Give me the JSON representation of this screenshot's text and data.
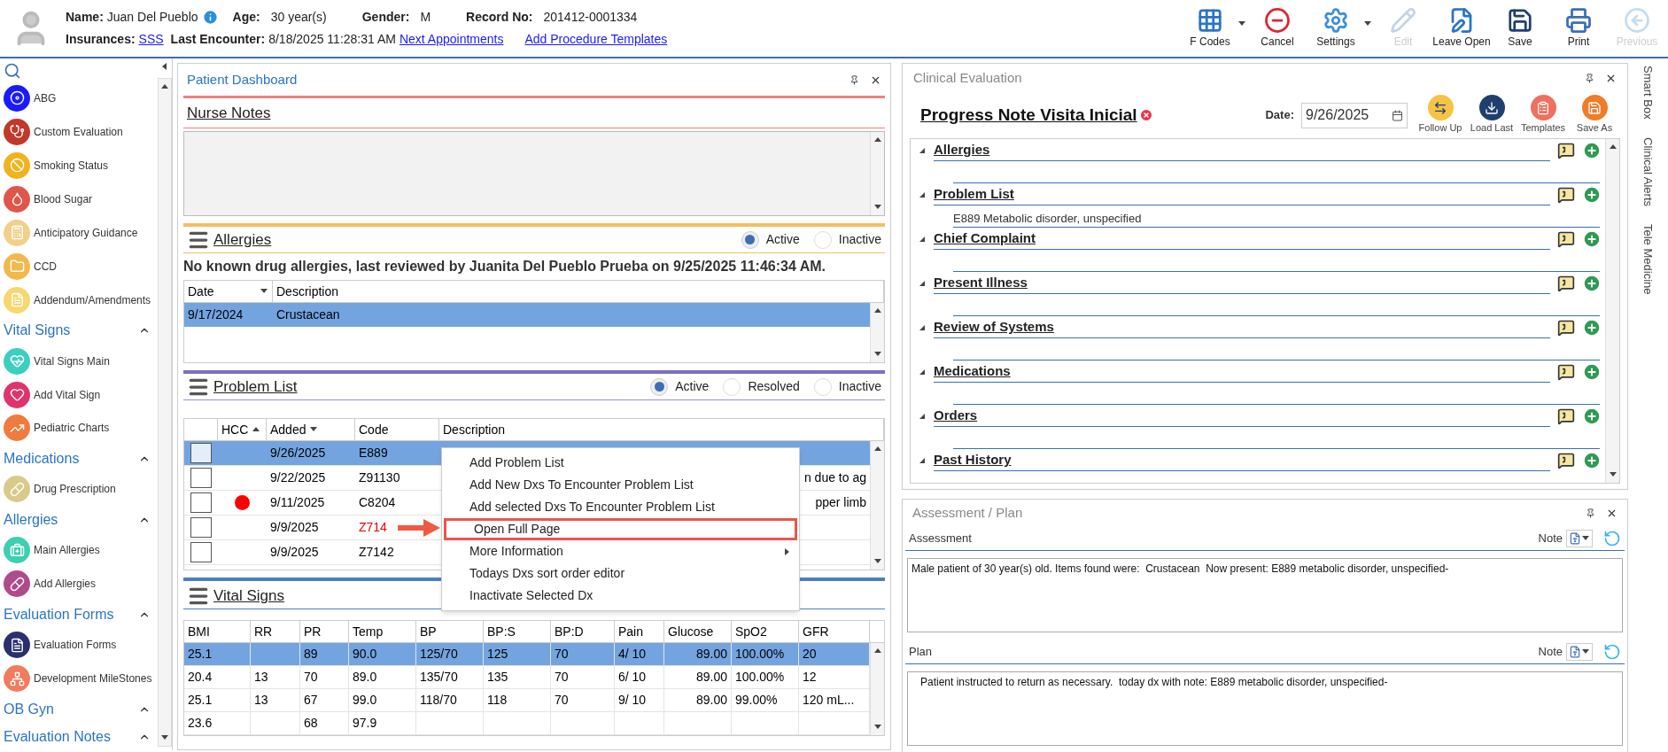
{
  "header": {
    "name_label": "Name:",
    "name": "Juan Del Pueblo",
    "age_label": "Age:",
    "age": "30 year(s)",
    "gender_label": "Gender:",
    "gender": "M",
    "record_label": "Record No:",
    "record": "201412-0001334",
    "insurances_label": "Insurances:",
    "insurance": "SSS",
    "last_encounter_label": "Last Encounter:",
    "last_encounter": "8/18/2025 11:28:31 AM",
    "links": [
      "Next Appointments",
      "Add Procedure Templates"
    ]
  },
  "toolbar": [
    {
      "kind": "fcodes",
      "label": "F Codes",
      "dropdown": true,
      "disabled": false
    },
    {
      "kind": "cancel",
      "label": "Cancel",
      "dropdown": false,
      "disabled": false
    },
    {
      "kind": "settings",
      "label": "Settings",
      "dropdown": true,
      "disabled": false
    },
    {
      "kind": "edit",
      "label": "Edit",
      "dropdown": false,
      "disabled": true
    },
    {
      "kind": "leave",
      "label": "Leave Open",
      "dropdown": false,
      "disabled": false
    },
    {
      "kind": "save",
      "label": "Save",
      "dropdown": false,
      "disabled": false
    },
    {
      "kind": "print",
      "label": "Print",
      "dropdown": false,
      "disabled": false
    },
    {
      "kind": "previous",
      "label": "Previous",
      "dropdown": false,
      "disabled": true
    }
  ],
  "sidebar": {
    "items": [
      {
        "kind": "item",
        "label": "ABG"
      },
      {
        "kind": "item",
        "label": "Custom Evaluation"
      },
      {
        "kind": "item",
        "label": "Smoking Status"
      },
      {
        "kind": "item",
        "label": "Blood Sugar"
      },
      {
        "kind": "item",
        "label": "Anticipatory Guidance"
      },
      {
        "kind": "item",
        "label": "CCD"
      },
      {
        "kind": "item",
        "label": "Addendum/Amendments"
      },
      {
        "kind": "section",
        "label": "Vital Signs",
        "expanded": true
      },
      {
        "kind": "item",
        "label": "Vital Signs Main"
      },
      {
        "kind": "item",
        "label": "Add Vital Sign"
      },
      {
        "kind": "item",
        "label": "Pediatric Charts"
      },
      {
        "kind": "section",
        "label": "Medications",
        "expanded": true
      },
      {
        "kind": "item",
        "label": "Drug Prescription"
      },
      {
        "kind": "section",
        "label": "Allergies",
        "expanded": true
      },
      {
        "kind": "item",
        "label": "Main Allergies"
      },
      {
        "kind": "item",
        "label": "Add Allergies"
      },
      {
        "kind": "section",
        "label": "Evaluation Forms",
        "expanded": true
      },
      {
        "kind": "item",
        "label": "Evaluation Forms"
      },
      {
        "kind": "item",
        "label": "Development MileStones"
      },
      {
        "kind": "section",
        "label": "OB Gyn",
        "expanded": true
      },
      {
        "kind": "section",
        "label": "Evaluation Notes",
        "expanded": true
      }
    ]
  },
  "dashboard": {
    "title": "Patient Dashboard",
    "nurse_notes": {
      "title": "Nurse Notes"
    },
    "allergies": {
      "title": "Allergies",
      "filters": [
        {
          "label": "Active",
          "selected": true
        },
        {
          "label": "Inactive",
          "selected": false
        }
      ],
      "summary": "No known drug allergies, last reviewed by Juanita Del Pueblo Prueba on 9/25/2025 11:46:34 AM.",
      "columns": [
        {
          "label": "Date",
          "sorted": true,
          "ascending": false
        },
        {
          "label": "Description",
          "sorted": false
        }
      ],
      "rows": [
        {
          "cells": [
            "9/17/2024",
            "Crustacean"
          ],
          "selected": true
        }
      ]
    },
    "problem_list": {
      "title": "Problem List",
      "filters": [
        {
          "label": "Active",
          "selected": true
        },
        {
          "label": "Resolved",
          "selected": false
        },
        {
          "label": "Inactive",
          "selected": false
        }
      ],
      "columns": [
        {
          "label": "HCC",
          "sorted": true,
          "ascending": true
        },
        {
          "label": "Added",
          "sorted": true,
          "ascending": false
        },
        {
          "label": "Code",
          "sorted": false
        },
        {
          "label": "Description",
          "sorted": false
        }
      ],
      "rows": [
        {
          "checked": false,
          "selected": true,
          "hcc": false,
          "added": "9/26/2025",
          "code": "E889",
          "flagged": false
        },
        {
          "checked": false,
          "selected": false,
          "hcc": false,
          "added": "9/22/2025",
          "code": "Z91130",
          "flagged": false,
          "description": "n due to ag"
        },
        {
          "checked": false,
          "selected": false,
          "hcc": true,
          "added": "9/11/2025",
          "code": "C8204",
          "flagged": false,
          "description": "pper limb"
        },
        {
          "checked": false,
          "selected": false,
          "hcc": false,
          "added": "9/9/2025",
          "code": "Z714",
          "flagged": true
        },
        {
          "checked": false,
          "selected": false,
          "hcc": false,
          "added": "9/9/2025",
          "code": "Z7142",
          "flagged": false
        }
      ],
      "context_menu": [
        {
          "label": "Add Problem List",
          "submenu": false,
          "highlighted": false
        },
        {
          "label": "Add New Dxs To Encounter Problem List",
          "submenu": false,
          "highlighted": false
        },
        {
          "label": "Add selected Dxs To Encounter Problem List",
          "submenu": false,
          "highlighted": false
        },
        {
          "label": "Open Full Page",
          "submenu": false,
          "highlighted": true
        },
        {
          "label": "More Information",
          "submenu": true,
          "highlighted": false
        },
        {
          "label": "Todays Dxs sort order editor",
          "submenu": false,
          "highlighted": false
        },
        {
          "label": "Inactivate Selected Dx",
          "submenu": false,
          "highlighted": false
        }
      ]
    },
    "vital_signs": {
      "title": "Vital Signs",
      "columns": [
        "BMI",
        "RR",
        "PR",
        "Temp",
        "BP",
        "BP:S",
        "BP:D",
        "Pain",
        "Glucose",
        "SpO2",
        "GFR"
      ],
      "rows": [
        {
          "cells": [
            "25.1",
            "",
            "89",
            "90.0",
            "125/70",
            "125",
            "70",
            "4/ 10",
            "89.00",
            "100.00%",
            "20"
          ],
          "selected": true
        },
        {
          "cells": [
            "20.4",
            "13",
            "70",
            "89.0",
            "135/70",
            "135",
            "70",
            "6/ 10",
            "89.00",
            "100.00%",
            "12"
          ],
          "selected": false
        },
        {
          "cells": [
            "25.1",
            "13",
            "67",
            "99.0",
            "118/70",
            "118",
            "70",
            "9/ 10",
            "89.00",
            "99.00%",
            "120 mL..."
          ],
          "selected": false
        },
        {
          "cells": [
            "23.6",
            "",
            "68",
            "97.9",
            "",
            "",
            "",
            "",
            "",
            "",
            ""
          ],
          "selected": false
        }
      ]
    }
  },
  "clinical_evaluation": {
    "title": "Clinical Evaluation",
    "note_title": "Progress Note Visita Inicial",
    "date_label": "Date:",
    "date": "9/26/2025",
    "actions": [
      {
        "kind": "follow",
        "label": "Follow Up"
      },
      {
        "kind": "load",
        "label": "Load Last"
      },
      {
        "kind": "templates",
        "label": "Templates"
      },
      {
        "kind": "saveas",
        "label": "Save As"
      }
    ],
    "sections": [
      {
        "title": "Allergies",
        "expanded": true
      },
      {
        "title": "Problem List",
        "expanded": true,
        "content": "E889 Metabolic disorder, unspecified"
      },
      {
        "title": "Chief Complaint",
        "expanded": true
      },
      {
        "title": "Present Illness",
        "expanded": true
      },
      {
        "title": "Review of Systems",
        "expanded": true
      },
      {
        "title": "Medications",
        "expanded": true
      },
      {
        "title": "Orders",
        "expanded": true
      },
      {
        "title": "Past History",
        "expanded": true
      }
    ]
  },
  "side_tabs": [
    "Smart Box",
    "Clinical Alerts",
    "Tele Medicine"
  ],
  "assessment_plan": {
    "title": "Assessment / Plan",
    "fields": [
      {
        "label": "Assessment",
        "note_label": "Note",
        "value": "Male patient of 30 year(s) old. Items found were:  Crustacean  Now present: E889 metabolic disorder, unspecified-"
      },
      {
        "label": "Plan",
        "note_label": "Note",
        "value": "   Patient instructed to return as necessary.  today dx with note: E889 metabolic disorder, unspecified-"
      }
    ]
  }
}
